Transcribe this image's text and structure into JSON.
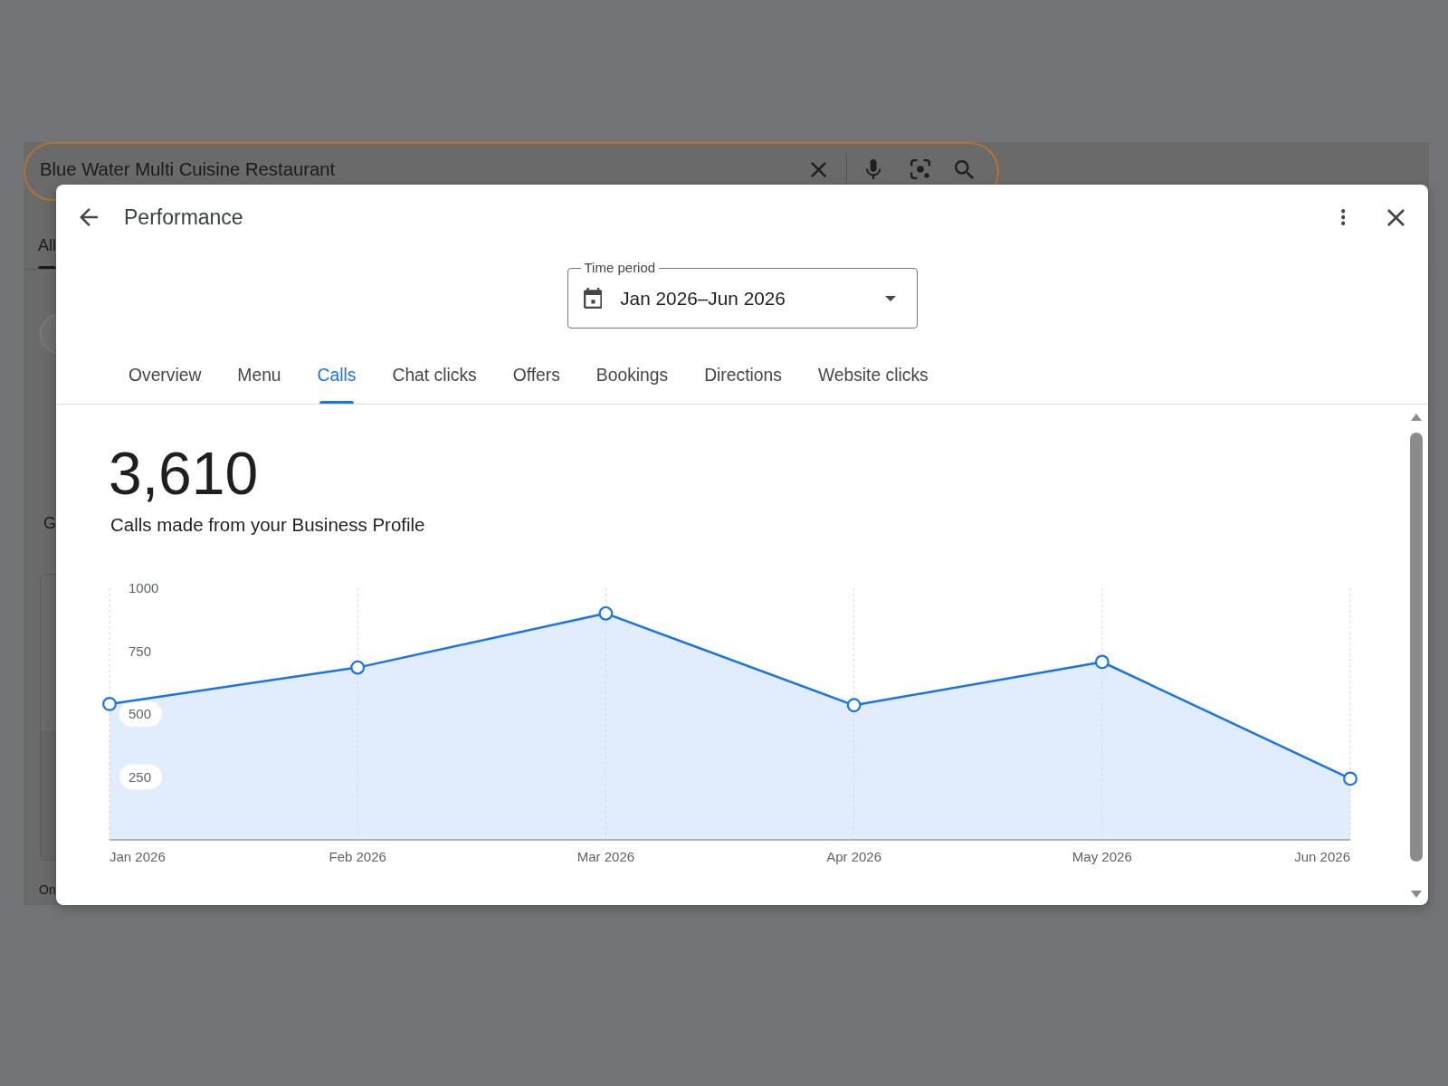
{
  "background_page": {
    "search": {
      "value": "Blue Water Multi Cuisine Restaurant"
    },
    "tabs": [
      {
        "label": "All",
        "selected": true
      }
    ],
    "text_1": "G",
    "text_2": "On"
  },
  "dialog": {
    "title": "Performance",
    "time_period": {
      "label": "Time period",
      "value": "Jan 2026–Jun 2026"
    },
    "tabs": [
      {
        "label": "Overview",
        "selected": false
      },
      {
        "label": "Menu",
        "selected": false
      },
      {
        "label": "Calls",
        "selected": true
      },
      {
        "label": "Chat clicks",
        "selected": false
      },
      {
        "label": "Offers",
        "selected": false
      },
      {
        "label": "Bookings",
        "selected": false
      },
      {
        "label": "Directions",
        "selected": false
      },
      {
        "label": "Website clicks",
        "selected": false
      }
    ],
    "metric": {
      "value": "3,610",
      "caption": "Calls made from your Business Profile"
    },
    "chart_data": {
      "type": "area",
      "categories": [
        "Jan 2026",
        "Feb 2026",
        "Mar 2026",
        "Apr 2026",
        "May 2026",
        "Jun 2026"
      ],
      "ylim": [
        0,
        1000
      ],
      "yticks": [
        250,
        500,
        750,
        1000
      ],
      "grid": "x",
      "series": [
        {
          "color": "#1a73e8",
          "values": [
            540,
            685,
            900,
            535,
            707,
            243
          ]
        }
      ]
    }
  }
}
